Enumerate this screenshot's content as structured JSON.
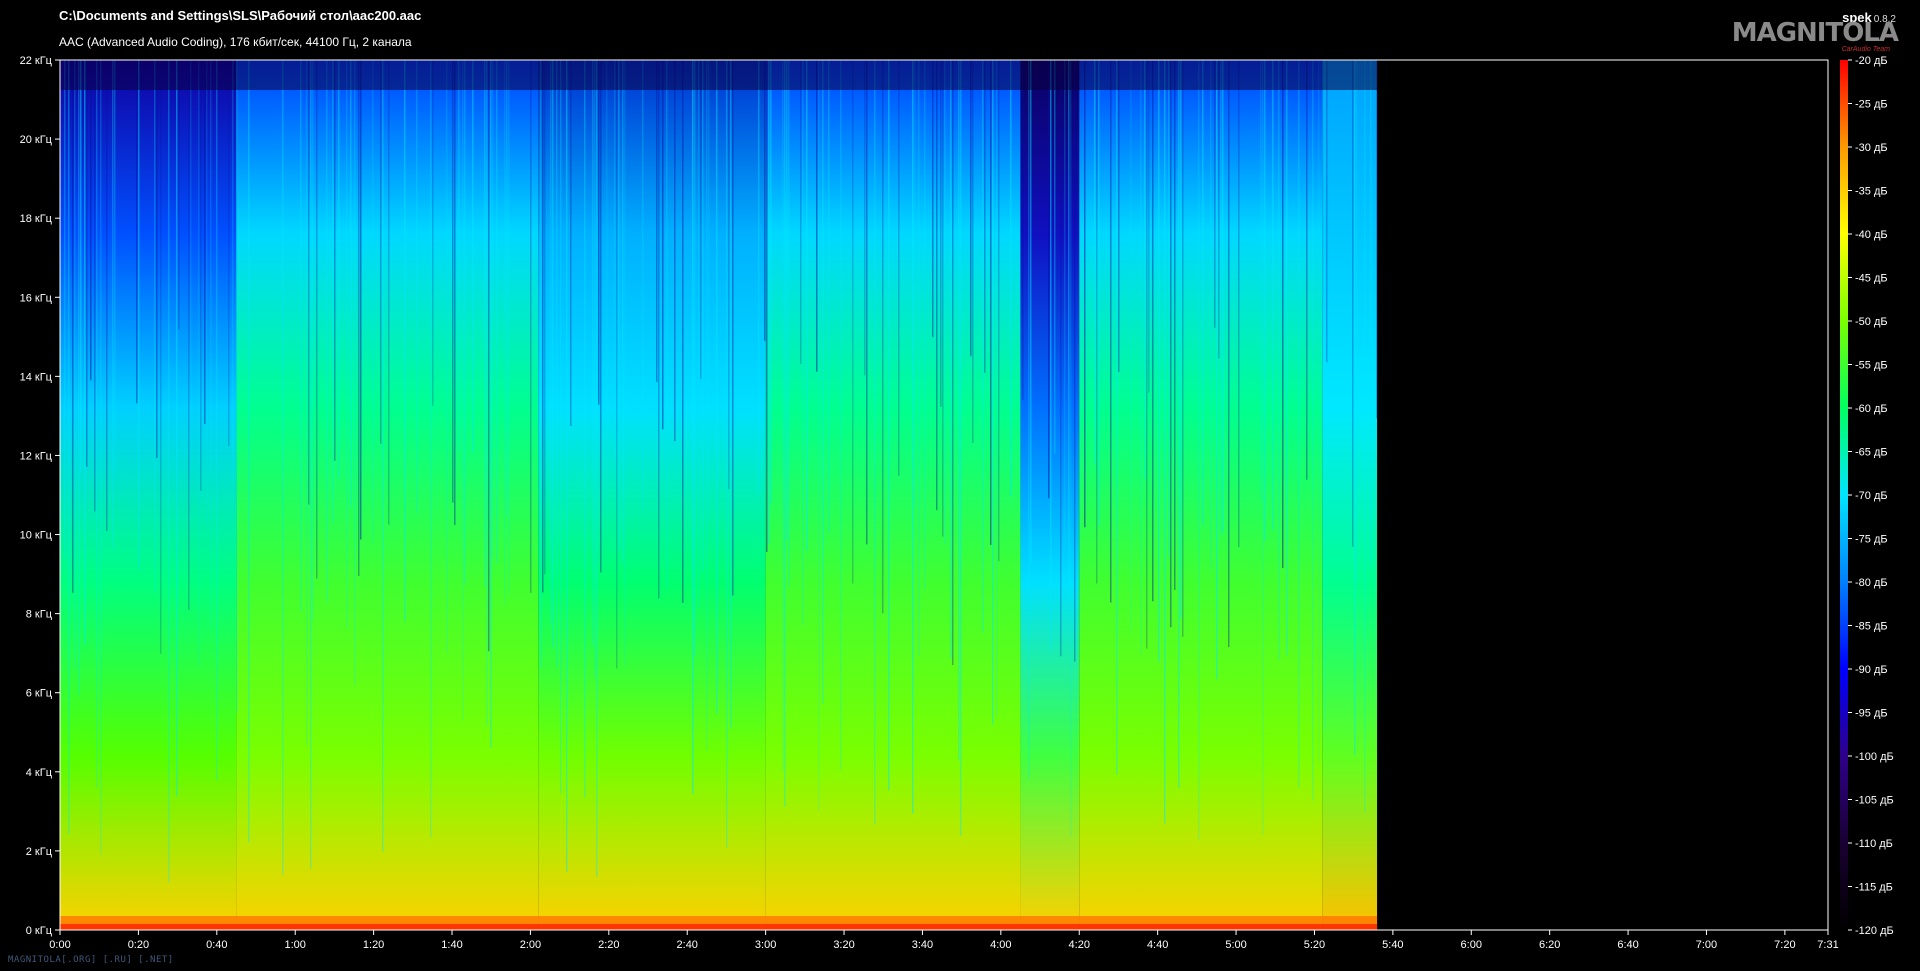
{
  "header": {
    "file_path": "C:\\Documents and Settings\\SLS\\Рабочий стол\\aac200.aac",
    "file_info": "AAC (Advanced Audio Coding), 176 кбит/сек, 44100 Гц, 2 канала",
    "app_name": "spek",
    "app_version": "0.8.2",
    "logo_text": "MAGNITOLA",
    "logo_subtitle": "CarAudio Team"
  },
  "watermark": "MAGNITOLA[.ORG] [.RU] [.NET]",
  "chart_data": {
    "type": "heatmap",
    "title": "",
    "xlabel": "",
    "ylabel": "",
    "x_ticks": [
      "0:00",
      "0:20",
      "0:40",
      "1:00",
      "1:20",
      "1:40",
      "2:00",
      "2:20",
      "2:40",
      "3:00",
      "3:20",
      "3:40",
      "4:00",
      "4:20",
      "4:40",
      "5:00",
      "5:20",
      "5:40",
      "6:00",
      "6:20",
      "6:40",
      "7:00",
      "7:20",
      "7:31"
    ],
    "x_tick_seconds": [
      0,
      20,
      40,
      60,
      80,
      100,
      120,
      140,
      160,
      180,
      200,
      220,
      240,
      260,
      280,
      300,
      320,
      340,
      360,
      380,
      400,
      420,
      440,
      451
    ],
    "x_range_seconds": [
      0,
      451
    ],
    "y_ticks": [
      "0 кГц",
      "2 кГц",
      "4 кГц",
      "6 кГц",
      "8 кГц",
      "10 кГц",
      "12 кГц",
      "14 кГц",
      "16 кГц",
      "18 кГц",
      "20 кГц",
      "22 кГц"
    ],
    "y_tick_values_khz": [
      0,
      2,
      4,
      6,
      8,
      10,
      12,
      14,
      16,
      18,
      20,
      22
    ],
    "y_range_khz": [
      0,
      22
    ],
    "colorbar_ticks": [
      "-20 дБ",
      "-25 дБ",
      "-30 дБ",
      "-35 дБ",
      "-40 дБ",
      "-45 дБ",
      "-50 дБ",
      "-55 дБ",
      "-60 дБ",
      "-65 дБ",
      "-70 дБ",
      "-75 дБ",
      "-80 дБ",
      "-85 дБ",
      "-90 дБ",
      "-95 дБ",
      "-100 дБ",
      "-105 дБ",
      "-110 дБ",
      "-115 дБ",
      "-120 дБ"
    ],
    "colorbar_range_db": [
      -120,
      -20
    ],
    "colormap": [
      "#000000",
      "#1a0033",
      "#2e008a",
      "#0000ff",
      "#0080ff",
      "#00e5ff",
      "#00ff60",
      "#7aff00",
      "#ffff00",
      "#ff9a00",
      "#ff0000"
    ],
    "audio_end_seconds": 336,
    "segments_seconds": [
      {
        "start": 0,
        "end": 45,
        "level": "blue-green"
      },
      {
        "start": 45,
        "end": 122,
        "level": "green"
      },
      {
        "start": 122,
        "end": 180,
        "level": "cyan-green"
      },
      {
        "start": 180,
        "end": 245,
        "level": "green"
      },
      {
        "start": 245,
        "end": 260,
        "level": "blue"
      },
      {
        "start": 260,
        "end": 322,
        "level": "green"
      },
      {
        "start": 322,
        "end": 336,
        "level": "cyan"
      }
    ]
  }
}
